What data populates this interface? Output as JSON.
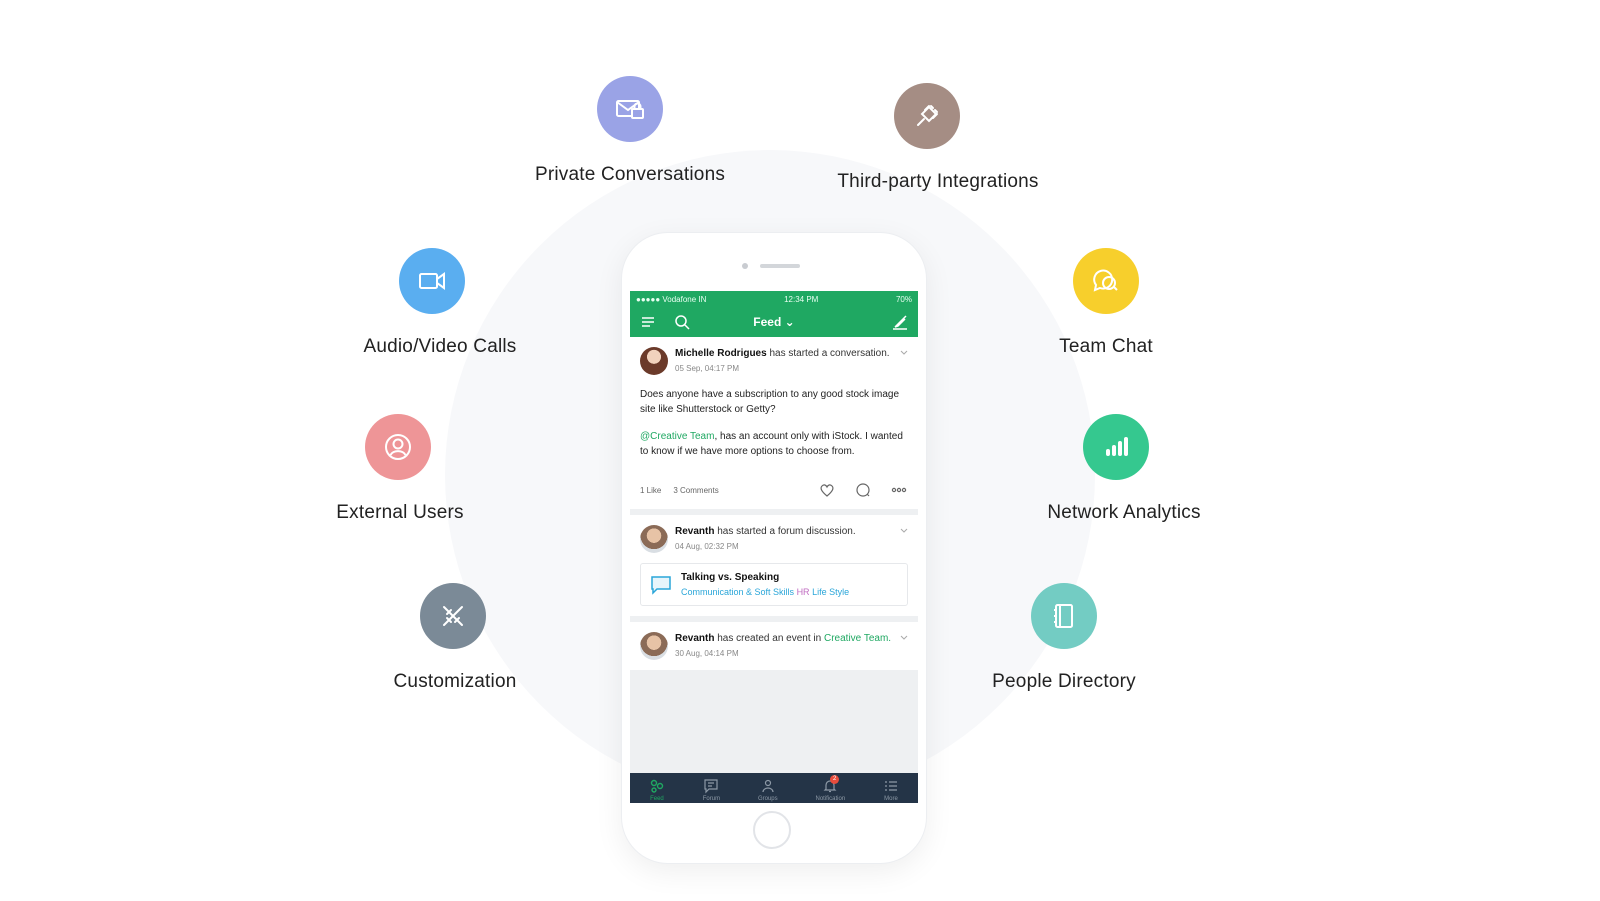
{
  "features": [
    {
      "id": "private-conversations",
      "label": "Private Conversations",
      "color": "#9aa3e6",
      "icon": "mail-lock-icon"
    },
    {
      "id": "third-party-integrations",
      "label": "Third-party Integrations",
      "color": "#a58d84",
      "icon": "plug-icon"
    },
    {
      "id": "audio-video-calls",
      "label": "Audio/Video Calls",
      "color": "#5aaef0",
      "icon": "video-camera-icon"
    },
    {
      "id": "team-chat",
      "label": "Team Chat",
      "color": "#f7cf2c",
      "icon": "chat-bubbles-icon"
    },
    {
      "id": "external-users",
      "label": "External Users",
      "color": "#ee9597",
      "icon": "user-circle-icon"
    },
    {
      "id": "network-analytics",
      "label": "Network Analytics",
      "color": "#35c88f",
      "icon": "bar-chart-icon"
    },
    {
      "id": "customization",
      "label": "Customization",
      "color": "#7b8a97",
      "icon": "tools-icon"
    },
    {
      "id": "people-directory",
      "label": "People Directory",
      "color": "#73ccc3",
      "icon": "address-book-icon"
    }
  ],
  "phone": {
    "status": {
      "carrier": "●●●●● Vodafone IN",
      "time": "12:34 PM",
      "battery": "70%"
    },
    "nav": {
      "title": "Feed ⌄"
    },
    "posts": [
      {
        "author": "Michelle Rodrigues",
        "action": " has started a conversation.",
        "time": "05 Sep, 04:17 PM",
        "text1": "Does anyone have a subscription to any good stock image site like Shutterstock or Getty?",
        "mention": "@Creative Team",
        "text2": ", has an account only with iStock. I wanted to know if we have more options to choose from.",
        "likes": "1 Like",
        "comments": "3 Comments"
      },
      {
        "author": "Revanth",
        "action": " has started a forum discussion.",
        "time": "04 Aug, 02:32 PM",
        "forum_title": "Talking vs. Speaking",
        "tag1": "Communication & Soft Skills",
        "tag2": "HR",
        "tag3": "Life Style"
      },
      {
        "author": "Revanth",
        "action": " has created an event in ",
        "group": "Creative Team.",
        "time": "30 Aug, 04:14 PM"
      }
    ],
    "tabs": [
      {
        "label": "Feed",
        "icon": "feed-icon",
        "active": true
      },
      {
        "label": "Forum",
        "icon": "forum-icon"
      },
      {
        "label": "Groups",
        "icon": "groups-icon"
      },
      {
        "label": "Notification",
        "icon": "bell-icon",
        "badge": "2"
      },
      {
        "label": "More",
        "icon": "more-list-icon"
      }
    ]
  }
}
